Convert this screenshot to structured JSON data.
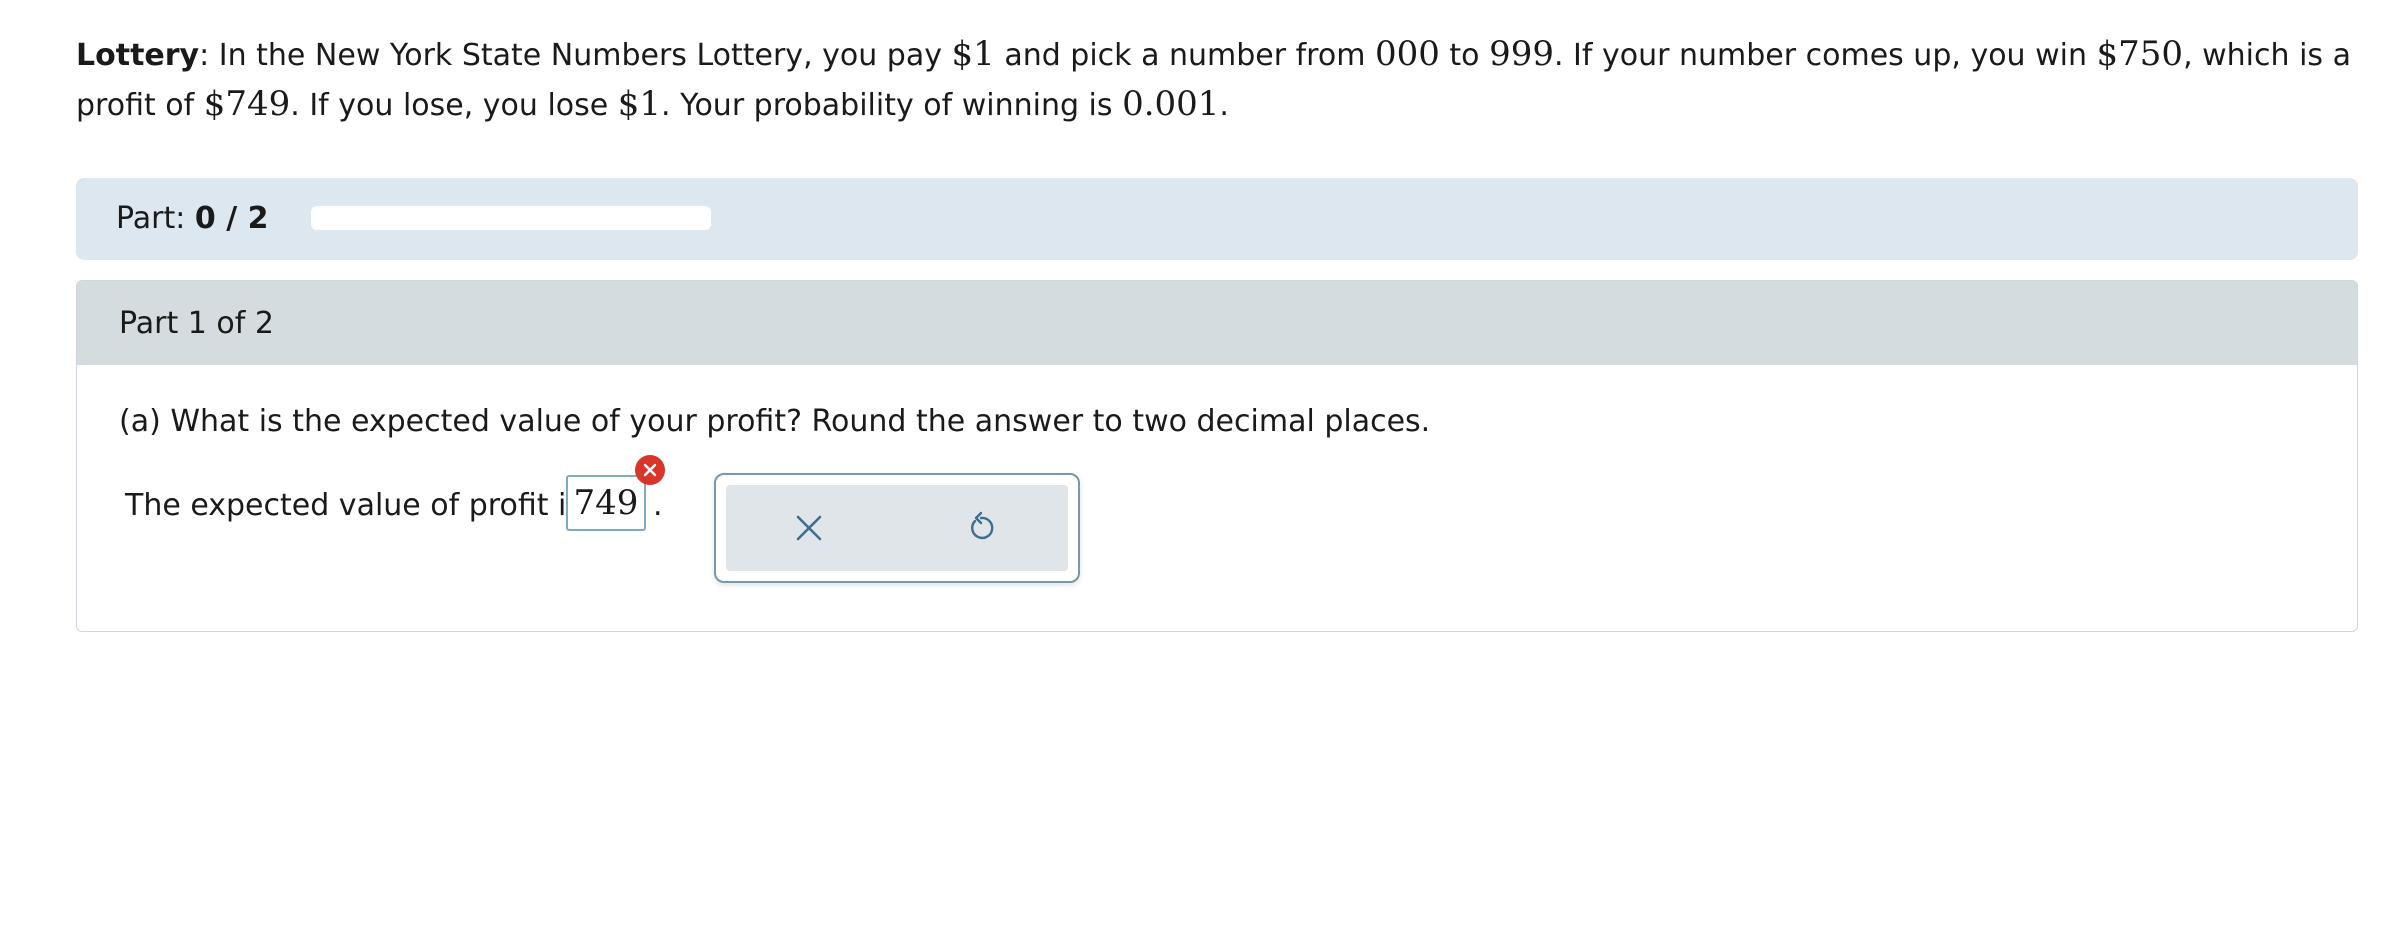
{
  "problem": {
    "title": "Lottery",
    "t1": ": In the New York State Numbers Lottery, you pay ",
    "m1": "$1",
    "t2": " and pick a number from ",
    "m2": "000",
    "t3": " to ",
    "m3": "999",
    "t4": ". If your number comes up, you win ",
    "m4": "$750",
    "t5": ", which is a profit of ",
    "m5": "$749",
    "t6": ". If you lose, you lose ",
    "m6": "$1",
    "t7": ". Your probability of winning is ",
    "m7": "0.001",
    "t8": "."
  },
  "progress": {
    "label": "Part: ",
    "value": "0 / 2",
    "fraction": 0
  },
  "part": {
    "title": "Part 1 of 2",
    "question": "(a) What is the expected value of your profit? Round the answer to two decimal places.",
    "answer_prefix": "The expected value of profit is",
    "answer_value": "749",
    "answer_suffix": "."
  },
  "tools": {
    "clear_icon": "x-icon",
    "reset_icon": "undo-icon"
  },
  "colors": {
    "progress_bg": "#dde7ef",
    "header_bg": "#d4dcdf",
    "error_badge": "#d9352b",
    "tool_icon": "#3b6e8f"
  }
}
